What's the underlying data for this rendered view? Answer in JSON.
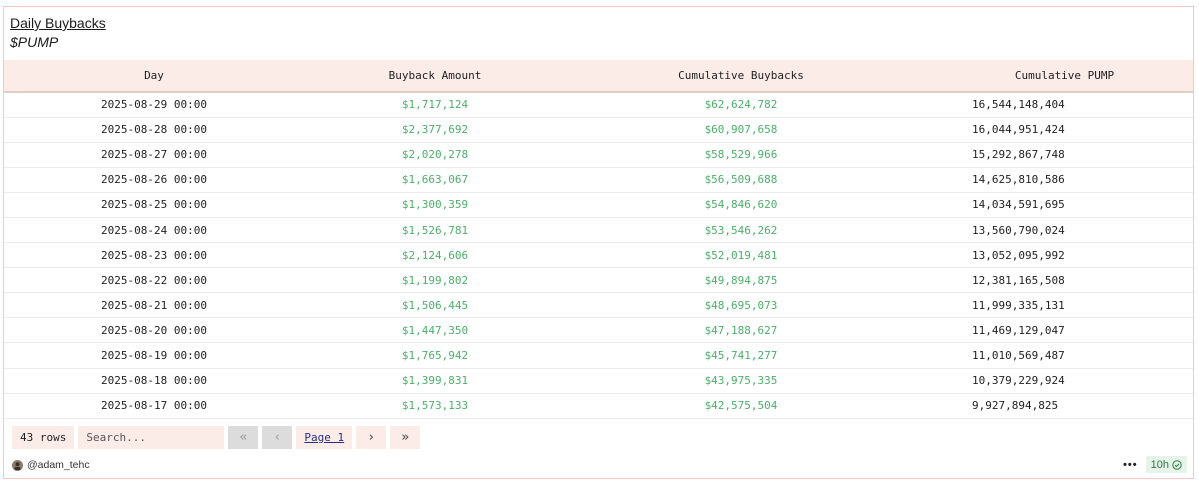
{
  "header": {
    "title": "Daily Buybacks",
    "subtitle": "$PUMP"
  },
  "table": {
    "columns": [
      "Day",
      "Buyback Amount",
      "Cumulative Buybacks",
      "Cumulative PUMP"
    ],
    "rows": [
      [
        "2025-08-29 00:00",
        "$1,717,124",
        "$62,624,782",
        "16,544,148,404"
      ],
      [
        "2025-08-28 00:00",
        "$2,377,692",
        "$60,907,658",
        "16,044,951,424"
      ],
      [
        "2025-08-27 00:00",
        "$2,020,278",
        "$58,529,966",
        "15,292,867,748"
      ],
      [
        "2025-08-26 00:00",
        "$1,663,067",
        "$56,509,688",
        "14,625,810,586"
      ],
      [
        "2025-08-25 00:00",
        "$1,300,359",
        "$54,846,620",
        "14,034,591,695"
      ],
      [
        "2025-08-24 00:00",
        "$1,526,781",
        "$53,546,262",
        "13,560,790,024"
      ],
      [
        "2025-08-23 00:00",
        "$2,124,606",
        "$52,019,481",
        "13,052,095,992"
      ],
      [
        "2025-08-22 00:00",
        "$1,199,802",
        "$49,894,875",
        "12,381,165,508"
      ],
      [
        "2025-08-21 00:00",
        "$1,506,445",
        "$48,695,073",
        "11,999,335,131"
      ],
      [
        "2025-08-20 00:00",
        "$1,447,350",
        "$47,188,627",
        "11,469,129,047"
      ],
      [
        "2025-08-19 00:00",
        "$1,765,942",
        "$45,741,277",
        "11,010,569,487"
      ],
      [
        "2025-08-18 00:00",
        "$1,399,831",
        "$43,975,335",
        "10,379,229,924"
      ],
      [
        "2025-08-17 00:00",
        "$1,573,133",
        "$42,575,504",
        "9,927,894,825"
      ]
    ]
  },
  "controls": {
    "rows_count": "43 rows",
    "search_placeholder": "Search...",
    "first_page_icon": "«",
    "prev_page_icon": "‹",
    "page_label": "Page 1",
    "next_page_icon": "›",
    "last_page_icon": "»"
  },
  "footer": {
    "author": "@adam_tehc",
    "more_icon": "•••",
    "freshness": "10h",
    "freshness_icon": "check-circle-icon",
    "colors": {
      "accent_bg": "#fbece8",
      "positive_text": "#4caf6a",
      "badge_bg": "#e6f3e8"
    }
  }
}
